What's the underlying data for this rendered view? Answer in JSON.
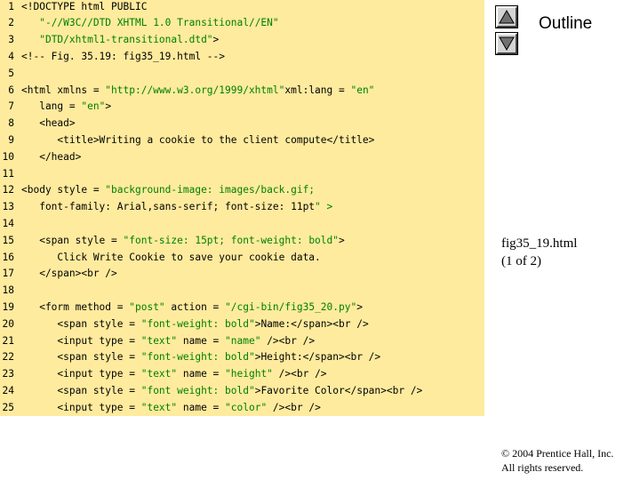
{
  "nav": {
    "outline_label": "Outline",
    "up_icon": "triangle-up-icon",
    "down_icon": "triangle-down-icon"
  },
  "file": {
    "name": "fig35_19.html",
    "page": "(1 of 2)"
  },
  "footer": {
    "copyright_line1": "© 2004 Prentice Hall, Inc.",
    "copyright_line2": "All rights reserved."
  },
  "colors": {
    "code_background": "#ffeb9e",
    "string_color": "#008000"
  },
  "code_lines": [
    {
      "num": "1",
      "text": "<!DOCTYPE html PUBLIC"
    },
    {
      "num": "2",
      "text": "   \"-//W3C//DTD XHTML 1.0 Transitional//EN\""
    },
    {
      "num": "3",
      "text": "   \"DTD/xhtml1-transitional.dtd\">"
    },
    {
      "num": "4",
      "text": "<!-- Fig. 35.19: fig35_19.html -->"
    },
    {
      "num": "5",
      "text": ""
    },
    {
      "num": "6",
      "text": "<html xmlns = \"http://www.w3.org/1999/xhtml\"xml:lang = \"en\""
    },
    {
      "num": "7",
      "text": "   lang = \"en\">"
    },
    {
      "num": "8",
      "text": "   <head>"
    },
    {
      "num": "9",
      "text": "      <title>Writing a cookie to the client compute</title>"
    },
    {
      "num": "10",
      "text": "   </head>"
    },
    {
      "num": "11",
      "text": ""
    },
    {
      "num": "12",
      "text": "<body style = \"background-image: images/back.gif;"
    },
    {
      "num": "13",
      "text": "   font-family: Arial,sans-serif; font-size: 11pt\" >"
    },
    {
      "num": "14",
      "text": ""
    },
    {
      "num": "15",
      "text": "   <span style = \"font-size: 15pt; font-weight: bold\">"
    },
    {
      "num": "16",
      "text": "      Click Write Cookie to save your cookie data."
    },
    {
      "num": "17",
      "text": "   </span><br />"
    },
    {
      "num": "18",
      "text": ""
    },
    {
      "num": "19",
      "text": "   <form method = \"post\" action = \"/cgi-bin/fig35_20.py\">"
    },
    {
      "num": "20",
      "text": "      <span style = \"font-weight: bold\">Name:</span><br />"
    },
    {
      "num": "21",
      "text": "      <input type = \"text\" name = \"name\" /><br />"
    },
    {
      "num": "22",
      "text": "      <span style = \"font-weight: bold\">Height:</span><br />"
    },
    {
      "num": "23",
      "text": "      <input type = \"text\" name = \"height\" /><br />"
    },
    {
      "num": "24",
      "text": "      <span style = \"font weight: bold\">Favorite Color</span><br />"
    },
    {
      "num": "25",
      "text": "      <input type = \"text\" name = \"color\" /><br />"
    }
  ]
}
